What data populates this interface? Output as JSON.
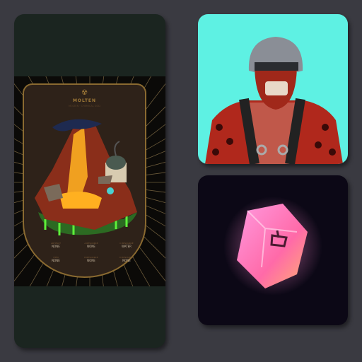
{
  "cards": {
    "volcano": {
      "logo_text": "MOLTEN",
      "subtitle": "MOLTEN · CHEMICAL GOD",
      "stats": [
        {
          "label": "ARTIFACT",
          "value": "NONE"
        },
        {
          "label": "A RESOURCE",
          "value": "NONE"
        },
        {
          "label": "C RESOURCE",
          "value": "WATER"
        },
        {
          "label": "ITEM",
          "value": "NONE"
        },
        {
          "label": "B RESOURCE",
          "value": "NONE"
        },
        {
          "label": "D RESOURCE",
          "value": "NONE"
        }
      ]
    },
    "character": {
      "background": "#5ef1e3"
    },
    "gem": {
      "background": "#0c0816",
      "color": "#ff7ac8"
    }
  }
}
